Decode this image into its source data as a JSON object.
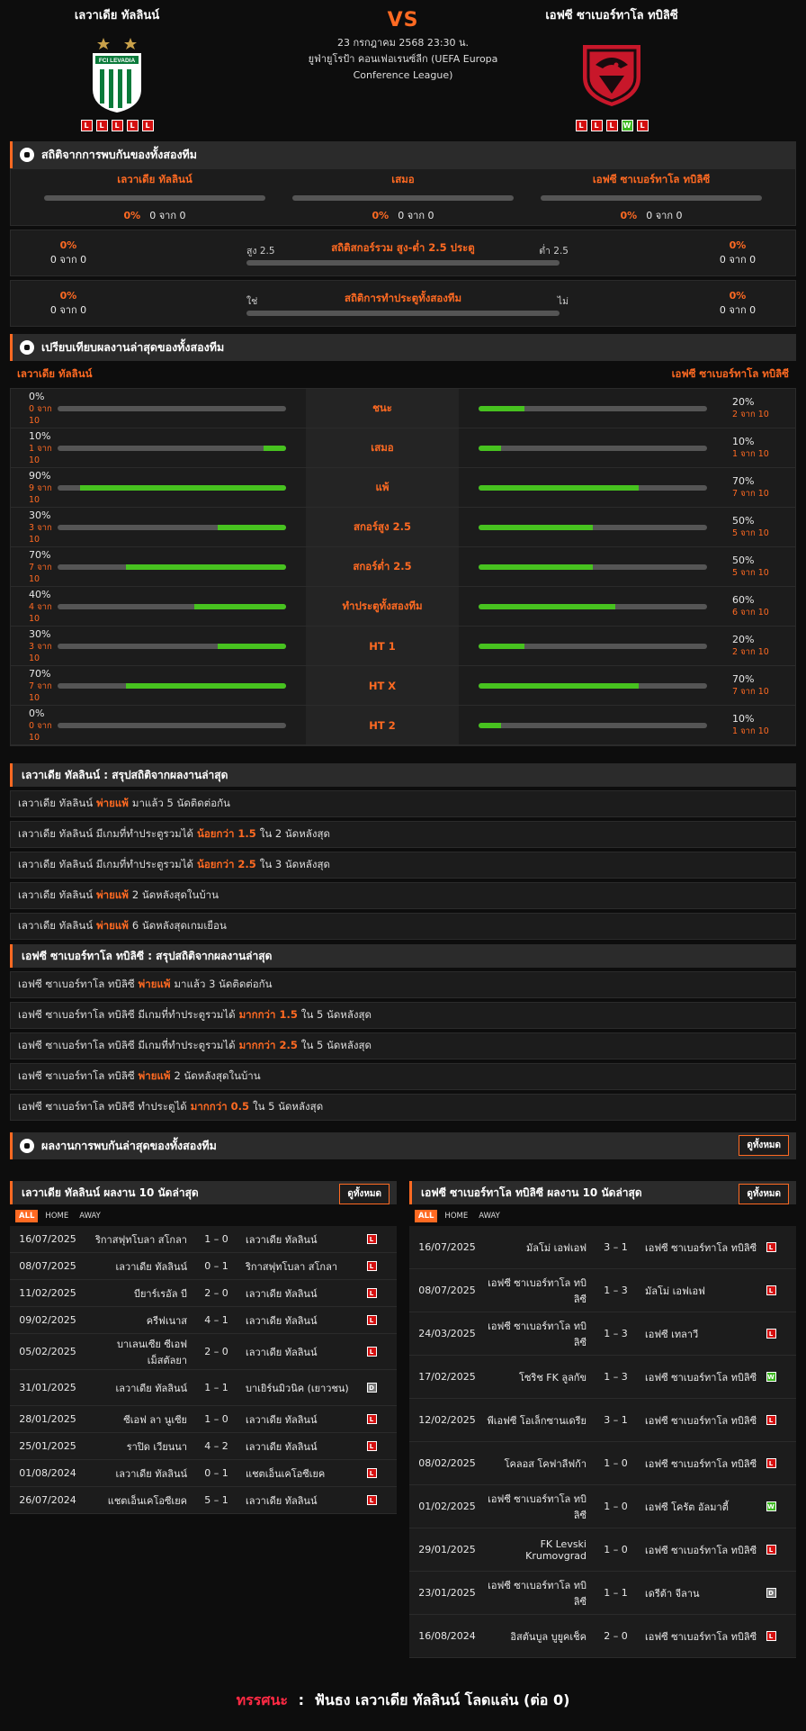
{
  "header": {
    "home": {
      "name": "เลวาเดีย ทัลลินน์",
      "crest_text": "FCI LEVADIA",
      "form": [
        "L",
        "L",
        "L",
        "L",
        "L"
      ]
    },
    "away": {
      "name": "เอฟซี ซาเบอร์ทาโล ทบิลิซี",
      "form": [
        "L",
        "L",
        "L",
        "W",
        "L"
      ]
    },
    "vs": "VS",
    "datetime": "23 กรกฎาคม 2568 23:30 น.",
    "competition": "ยูฟ่ายูโรป้า คอนเฟอเรนซ์ลีก (UEFA Europa Conference League)"
  },
  "h2h": {
    "title": "สถิติจากการพบกันของทั้งสองทีม",
    "cols": [
      {
        "label": "เลวาเดีย ทัลลินน์",
        "pct": "0%",
        "count": "0 จาก 0",
        "fill": 0
      },
      {
        "label": "เสมอ",
        "pct": "0%",
        "count": "0 จาก 0",
        "fill": 0
      },
      {
        "label": "เอฟซี ซาเบอร์ทาโล ทบิลิซี",
        "pct": "0%",
        "count": "0 จาก 0",
        "fill": 0
      }
    ],
    "ou": {
      "title": "สถิติสกอร์รวม สูง-ต่ำ 2.5 ประตู",
      "left_label": "สูง 2.5",
      "right_label": "ต่ำ 2.5",
      "left_pct": "0%",
      "left_count": "0 จาก 0",
      "right_pct": "0%",
      "right_count": "0 จาก 0",
      "fill": 0
    },
    "btts": {
      "title": "สถิติการทำประตูทั้งสองทีม",
      "left_label": "ใช่",
      "right_label": "ไม่",
      "left_pct": "0%",
      "left_count": "0 จาก 0",
      "right_pct": "0%",
      "right_count": "0 จาก 0",
      "fill": 0
    }
  },
  "compare": {
    "title": "เปรียบเทียบผลงานล่าสุดของทั้งสองทีม",
    "home_name": "เลวาเดีย ทัลลินน์",
    "away_name": "เอฟซี ซาเบอร์ทาโล ทบิลิซี",
    "rows": [
      {
        "label": "ชนะ",
        "l_pct": "0%",
        "l_cnt": "0 จาก 10",
        "l_fill": 0,
        "r_pct": "20%",
        "r_cnt": "2 จาก 10",
        "r_fill": 0.2
      },
      {
        "label": "เสมอ",
        "l_pct": "10%",
        "l_cnt": "1 จาก 10",
        "l_fill": 0.1,
        "r_pct": "10%",
        "r_cnt": "1 จาก 10",
        "r_fill": 0.1
      },
      {
        "label": "แพ้",
        "l_pct": "90%",
        "l_cnt": "9 จาก 10",
        "l_fill": 0.9,
        "r_pct": "70%",
        "r_cnt": "7 จาก 10",
        "r_fill": 0.7
      },
      {
        "label": "สกอร์สูง 2.5",
        "l_pct": "30%",
        "l_cnt": "3 จาก 10",
        "l_fill": 0.3,
        "r_pct": "50%",
        "r_cnt": "5 จาก 10",
        "r_fill": 0.5
      },
      {
        "label": "สกอร์ต่ำ 2.5",
        "l_pct": "70%",
        "l_cnt": "7 จาก 10",
        "l_fill": 0.7,
        "r_pct": "50%",
        "r_cnt": "5 จาก 10",
        "r_fill": 0.5
      },
      {
        "label": "ทำประตูทั้งสองทีม",
        "l_pct": "40%",
        "l_cnt": "4 จาก 10",
        "l_fill": 0.4,
        "r_pct": "60%",
        "r_cnt": "6 จาก 10",
        "r_fill": 0.6
      },
      {
        "label": "HT 1",
        "l_pct": "30%",
        "l_cnt": "3 จาก 10",
        "l_fill": 0.3,
        "r_pct": "20%",
        "r_cnt": "2 จาก 10",
        "r_fill": 0.2
      },
      {
        "label": "HT X",
        "l_pct": "70%",
        "l_cnt": "7 จาก 10",
        "l_fill": 0.7,
        "r_pct": "70%",
        "r_cnt": "7 จาก 10",
        "r_fill": 0.7
      },
      {
        "label": "HT 2",
        "l_pct": "0%",
        "l_cnt": "0 จาก 10",
        "l_fill": 0,
        "r_pct": "10%",
        "r_cnt": "1 จาก 10",
        "r_fill": 0.1
      }
    ]
  },
  "home_summary": {
    "title": "เลวาเดีย ทัลลินน์ : สรุปสถิติจากผลงานล่าสุด",
    "lines": [
      {
        "pre": "เลวาเดีย ทัลลินน์",
        "hl": "พ่ายแพ้",
        "post": "มาแล้ว 5 นัดติดต่อกัน"
      },
      {
        "pre": "เลวาเดีย ทัลลินน์ มีเกมที่ทำประตูรวมได้",
        "hl": "น้อยกว่า 1.5",
        "post": "ใน 2 นัดหลังสุด"
      },
      {
        "pre": "เลวาเดีย ทัลลินน์ มีเกมที่ทำประตูรวมได้",
        "hl": "น้อยกว่า 2.5",
        "post": "ใน 3 นัดหลังสุด"
      },
      {
        "pre": "เลวาเดีย ทัลลินน์",
        "hl": "พ่ายแพ้",
        "post": "2 นัดหลังสุดในบ้าน"
      },
      {
        "pre": "เลวาเดีย ทัลลินน์",
        "hl": "พ่ายแพ้",
        "post": "6 นัดหลังสุดเกมเยือน"
      }
    ]
  },
  "away_summary": {
    "title": "เอฟซี ซาเบอร์ทาโล ทบิลิซี : สรุปสถิติจากผลงานล่าสุด",
    "lines": [
      {
        "pre": "เอฟซี ซาเบอร์ทาโล ทบิลิซี",
        "hl": "พ่ายแพ้",
        "post": "มาแล้ว 3 นัดติดต่อกัน"
      },
      {
        "pre": "เอฟซี ซาเบอร์ทาโล ทบิลิซี มีเกมที่ทำประตูรวมได้",
        "hl": "มากกว่า 1.5",
        "post": "ใน 5 นัดหลังสุด"
      },
      {
        "pre": "เอฟซี ซาเบอร์ทาโล ทบิลิซี มีเกมที่ทำประตูรวมได้",
        "hl": "มากกว่า 2.5",
        "post": "ใน 5 นัดหลังสุด"
      },
      {
        "pre": "เอฟซี ซาเบอร์ทาโล ทบิลิซี",
        "hl": "พ่ายแพ้",
        "post": "2 นัดหลังสุดในบ้าน"
      },
      {
        "pre": "เอฟซี ซาเบอร์ทาโล ทบิลิซี ทำประตูได้",
        "hl": "มากกว่า 0.5",
        "post": "ใน 5 นัดหลังสุด"
      }
    ]
  },
  "recent": {
    "title": "ผลงานการพบกันล่าสุดของทั้งสองทีม",
    "view_all": "ดูทั้งหมด",
    "tabs": [
      "ALL",
      "HOME",
      "AWAY"
    ],
    "home": {
      "title": "เลวาเดีย ทัลลินน์ ผลงาน 10 นัดล่าสุด",
      "rows": [
        {
          "date": "16/07/2025",
          "home": "ริกาสฟุทโบลา สโกลา",
          "score": "1 – 0",
          "away": "เลวาเดีย ทัลลินน์",
          "res": "L"
        },
        {
          "date": "08/07/2025",
          "home": "เลวาเดีย ทัลลินน์",
          "score": "0 – 1",
          "away": "ริกาสฟุทโบลา สโกลา",
          "res": "L"
        },
        {
          "date": "11/02/2025",
          "home": "บียาร์เรอัล บี",
          "score": "2 – 0",
          "away": "เลวาเดีย ทัลลินน์",
          "res": "L"
        },
        {
          "date": "09/02/2025",
          "home": "ครีฟเนาส",
          "score": "4 – 1",
          "away": "เลวาเดีย ทัลลินน์",
          "res": "L"
        },
        {
          "date": "05/02/2025",
          "home": "บาเลนเซีย ซีเอฟ เม็สตัลยา",
          "score": "2 – 0",
          "away": "เลวาเดีย ทัลลินน์",
          "res": "L"
        },
        {
          "date": "31/01/2025",
          "home": "เลวาเดีย ทัลลินน์",
          "score": "1 – 1",
          "away": "บาเยิร์นมิวนิค (เยาวชน)",
          "res": "D"
        },
        {
          "date": "28/01/2025",
          "home": "ซีเอฟ ลา นูเซีย",
          "score": "1 – 0",
          "away": "เลวาเดีย ทัลลินน์",
          "res": "L"
        },
        {
          "date": "25/01/2025",
          "home": "ราปิด เวียนนา",
          "score": "4 – 2",
          "away": "เลวาเดีย ทัลลินน์",
          "res": "L"
        },
        {
          "date": "01/08/2024",
          "home": "เลวาเดีย ทัลลินน์",
          "score": "0 – 1",
          "away": "แชตเอ็นเคโอซีเยค",
          "res": "L"
        },
        {
          "date": "26/07/2024",
          "home": "แชตเอ็นเคโอซีเยค",
          "score": "5 – 1",
          "away": "เลวาเดีย ทัลลินน์",
          "res": "L"
        }
      ]
    },
    "away": {
      "title": "เอฟซี ซาเบอร์ทาโล ทบิลิซี ผลงาน 10 นัดล่าสุด",
      "rows": [
        {
          "date": "16/07/2025",
          "home": "มัลโม่ เอฟเอฟ",
          "score": "3 – 1",
          "away": "เอฟซี ซาเบอร์ทาโล ทบิลิซี",
          "res": "L"
        },
        {
          "date": "08/07/2025",
          "home": "เอฟซี ซาเบอร์ทาโล ทบิลิซี",
          "score": "1 – 3",
          "away": "มัลโม่ เอฟเอฟ",
          "res": "L"
        },
        {
          "date": "24/03/2025",
          "home": "เอฟซี ซาเบอร์ทาโล ทบิลิซี",
          "score": "1 – 3",
          "away": "เอฟซี เทลาวี",
          "res": "L"
        },
        {
          "date": "17/02/2025",
          "home": "โซริช FK ลูลกัข",
          "score": "1 – 3",
          "away": "เอฟซี ซาเบอร์ทาโล ทบิลิซี",
          "res": "W"
        },
        {
          "date": "12/02/2025",
          "home": "พีเอฟซี โอเล็กซานเดรีย",
          "score": "3 – 1",
          "away": "เอฟซี ซาเบอร์ทาโล ทบิลิซี",
          "res": "L"
        },
        {
          "date": "08/02/2025",
          "home": "โคลอส โคฟาลีฟก้า",
          "score": "1 – 0",
          "away": "เอฟซี ซาเบอร์ทาโล ทบิลิซี",
          "res": "L"
        },
        {
          "date": "01/02/2025",
          "home": "เอฟซี ซาเบอร์ทาโล ทบิลิซี",
          "score": "1 – 0",
          "away": "เอฟซี โครัต อัลมาตี้",
          "res": "W"
        },
        {
          "date": "29/01/2025",
          "home": "FK Levski Krumovgrad",
          "score": "1 – 0",
          "away": "เอฟซี ซาเบอร์ทาโล ทบิลิซี",
          "res": "L"
        },
        {
          "date": "23/01/2025",
          "home": "เอฟซี ซาเบอร์ทาโล ทบิลิซี",
          "score": "1 – 1",
          "away": "เดรีต้า จีลาน",
          "res": "D"
        },
        {
          "date": "16/08/2024",
          "home": "อิสตันบูล บูยูคเช็ค",
          "score": "2 – 0",
          "away": "เอฟซี ซาเบอร์ทาโล ทบิลิซี",
          "res": "L"
        }
      ]
    }
  },
  "tip": {
    "label": "ทรรศนะ",
    "sep": ":",
    "text": "ฟันธง เลวาเดีย ทัลลินน์ โลดแล่น (ต่อ 0)"
  },
  "colors": {
    "accent": "#ff6a22",
    "win": "#3db821",
    "loss": "#d40f0f",
    "draw": "#777777",
    "bar_fill": "#47c21f"
  }
}
